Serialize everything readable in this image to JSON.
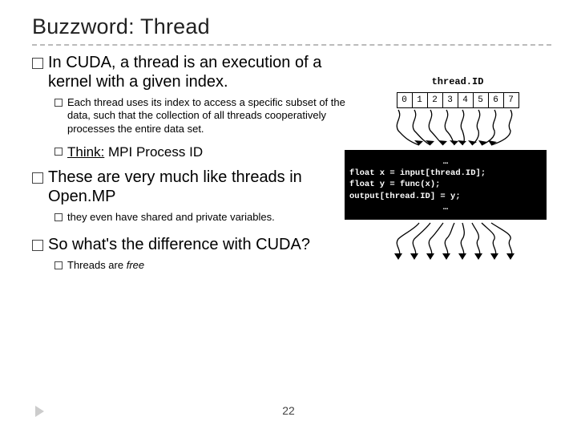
{
  "title": "Buzzword: Thread",
  "b1": {
    "pre": "In ",
    "cuda": "CUDA,",
    "post": " a thread is an execution of a kernel with a given index."
  },
  "b1a": "Each thread uses its index to access a specific subset of the data, such that the collection of all threads cooperatively processes the entire data set.",
  "b1b_think": "Think:",
  "b1b_rest": " MPI Process ID",
  "b2": "These are very much like threads in Open.MP",
  "b2a": "they even have shared and private variables.",
  "b3": "So what's the difference with CUDA?",
  "b3a_pre": "Threads are ",
  "b3a_free": "free",
  "tid_label": "thread.ID",
  "cells": [
    "0",
    "1",
    "2",
    "3",
    "4",
    "5",
    "6",
    "7"
  ],
  "code": {
    "dots1": "…",
    "l1": "float x = input[thread.ID];",
    "l2": "float y = func(x);",
    "l3": "output[thread.ID] = y;",
    "dots2": "…"
  },
  "pagenum": "22"
}
